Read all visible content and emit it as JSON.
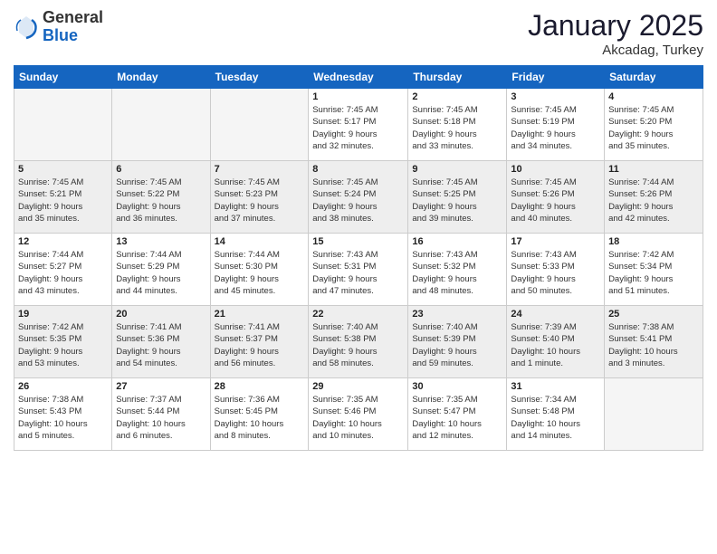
{
  "logo": {
    "general": "General",
    "blue": "Blue"
  },
  "title": "January 2025",
  "location": "Akcadag, Turkey",
  "days_header": [
    "Sunday",
    "Monday",
    "Tuesday",
    "Wednesday",
    "Thursday",
    "Friday",
    "Saturday"
  ],
  "weeks": [
    [
      {
        "day": "",
        "info": ""
      },
      {
        "day": "",
        "info": ""
      },
      {
        "day": "",
        "info": ""
      },
      {
        "day": "1",
        "info": "Sunrise: 7:45 AM\nSunset: 5:17 PM\nDaylight: 9 hours\nand 32 minutes."
      },
      {
        "day": "2",
        "info": "Sunrise: 7:45 AM\nSunset: 5:18 PM\nDaylight: 9 hours\nand 33 minutes."
      },
      {
        "day": "3",
        "info": "Sunrise: 7:45 AM\nSunset: 5:19 PM\nDaylight: 9 hours\nand 34 minutes."
      },
      {
        "day": "4",
        "info": "Sunrise: 7:45 AM\nSunset: 5:20 PM\nDaylight: 9 hours\nand 35 minutes."
      }
    ],
    [
      {
        "day": "5",
        "info": "Sunrise: 7:45 AM\nSunset: 5:21 PM\nDaylight: 9 hours\nand 35 minutes."
      },
      {
        "day": "6",
        "info": "Sunrise: 7:45 AM\nSunset: 5:22 PM\nDaylight: 9 hours\nand 36 minutes."
      },
      {
        "day": "7",
        "info": "Sunrise: 7:45 AM\nSunset: 5:23 PM\nDaylight: 9 hours\nand 37 minutes."
      },
      {
        "day": "8",
        "info": "Sunrise: 7:45 AM\nSunset: 5:24 PM\nDaylight: 9 hours\nand 38 minutes."
      },
      {
        "day": "9",
        "info": "Sunrise: 7:45 AM\nSunset: 5:25 PM\nDaylight: 9 hours\nand 39 minutes."
      },
      {
        "day": "10",
        "info": "Sunrise: 7:45 AM\nSunset: 5:26 PM\nDaylight: 9 hours\nand 40 minutes."
      },
      {
        "day": "11",
        "info": "Sunrise: 7:44 AM\nSunset: 5:26 PM\nDaylight: 9 hours\nand 42 minutes."
      }
    ],
    [
      {
        "day": "12",
        "info": "Sunrise: 7:44 AM\nSunset: 5:27 PM\nDaylight: 9 hours\nand 43 minutes."
      },
      {
        "day": "13",
        "info": "Sunrise: 7:44 AM\nSunset: 5:29 PM\nDaylight: 9 hours\nand 44 minutes."
      },
      {
        "day": "14",
        "info": "Sunrise: 7:44 AM\nSunset: 5:30 PM\nDaylight: 9 hours\nand 45 minutes."
      },
      {
        "day": "15",
        "info": "Sunrise: 7:43 AM\nSunset: 5:31 PM\nDaylight: 9 hours\nand 47 minutes."
      },
      {
        "day": "16",
        "info": "Sunrise: 7:43 AM\nSunset: 5:32 PM\nDaylight: 9 hours\nand 48 minutes."
      },
      {
        "day": "17",
        "info": "Sunrise: 7:43 AM\nSunset: 5:33 PM\nDaylight: 9 hours\nand 50 minutes."
      },
      {
        "day": "18",
        "info": "Sunrise: 7:42 AM\nSunset: 5:34 PM\nDaylight: 9 hours\nand 51 minutes."
      }
    ],
    [
      {
        "day": "19",
        "info": "Sunrise: 7:42 AM\nSunset: 5:35 PM\nDaylight: 9 hours\nand 53 minutes."
      },
      {
        "day": "20",
        "info": "Sunrise: 7:41 AM\nSunset: 5:36 PM\nDaylight: 9 hours\nand 54 minutes."
      },
      {
        "day": "21",
        "info": "Sunrise: 7:41 AM\nSunset: 5:37 PM\nDaylight: 9 hours\nand 56 minutes."
      },
      {
        "day": "22",
        "info": "Sunrise: 7:40 AM\nSunset: 5:38 PM\nDaylight: 9 hours\nand 58 minutes."
      },
      {
        "day": "23",
        "info": "Sunrise: 7:40 AM\nSunset: 5:39 PM\nDaylight: 9 hours\nand 59 minutes."
      },
      {
        "day": "24",
        "info": "Sunrise: 7:39 AM\nSunset: 5:40 PM\nDaylight: 10 hours\nand 1 minute."
      },
      {
        "day": "25",
        "info": "Sunrise: 7:38 AM\nSunset: 5:41 PM\nDaylight: 10 hours\nand 3 minutes."
      }
    ],
    [
      {
        "day": "26",
        "info": "Sunrise: 7:38 AM\nSunset: 5:43 PM\nDaylight: 10 hours\nand 5 minutes."
      },
      {
        "day": "27",
        "info": "Sunrise: 7:37 AM\nSunset: 5:44 PM\nDaylight: 10 hours\nand 6 minutes."
      },
      {
        "day": "28",
        "info": "Sunrise: 7:36 AM\nSunset: 5:45 PM\nDaylight: 10 hours\nand 8 minutes."
      },
      {
        "day": "29",
        "info": "Sunrise: 7:35 AM\nSunset: 5:46 PM\nDaylight: 10 hours\nand 10 minutes."
      },
      {
        "day": "30",
        "info": "Sunrise: 7:35 AM\nSunset: 5:47 PM\nDaylight: 10 hours\nand 12 minutes."
      },
      {
        "day": "31",
        "info": "Sunrise: 7:34 AM\nSunset: 5:48 PM\nDaylight: 10 hours\nand 14 minutes."
      },
      {
        "day": "",
        "info": ""
      }
    ]
  ]
}
